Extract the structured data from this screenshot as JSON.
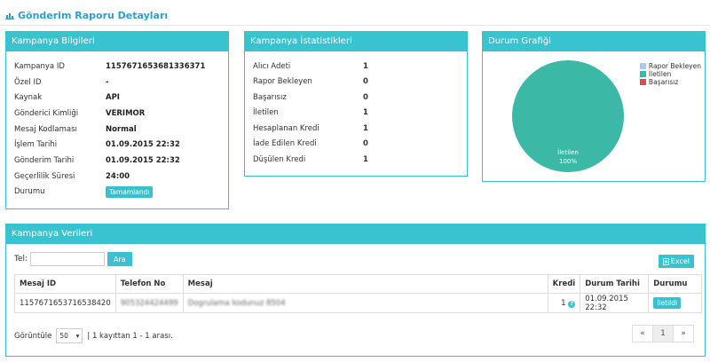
{
  "header": {
    "title": "Gönderim Raporu Detayları"
  },
  "campaign_info": {
    "title": "Kampanya Bilgileri",
    "rows": [
      {
        "key": "Kampanya ID",
        "value": "1157671653681336371"
      },
      {
        "key": "Özel ID",
        "value": "-"
      },
      {
        "key": "Kaynak",
        "value": "API"
      },
      {
        "key": "Gönderici Kimliği",
        "value": "VERIMOR"
      },
      {
        "key": "Mesaj Kodlaması",
        "value": "Normal"
      },
      {
        "key": "İşlem Tarihi",
        "value": "01.09.2015 22:32"
      },
      {
        "key": "Gönderim Tarihi",
        "value": "01.09.2015 22:32"
      },
      {
        "key": "Geçerlilik Süresi",
        "value": "24:00"
      }
    ],
    "status_label": "Durumu",
    "status_value": "Tamamlandı"
  },
  "campaign_stats": {
    "title": "Kampanya İstatistikleri",
    "rows": [
      {
        "key": "Alıcı Adeti",
        "value": "1"
      },
      {
        "key": "Rapor Bekleyen",
        "value": "0"
      },
      {
        "key": "Başarısız",
        "value": "0"
      },
      {
        "key": "İletilen",
        "value": "1"
      },
      {
        "key": "Hesaplanan Kredi",
        "value": "1"
      },
      {
        "key": "İade Edilen Kredi",
        "value": "0"
      },
      {
        "key": "Düşülen Kredi",
        "value": "1"
      }
    ]
  },
  "status_chart": {
    "title": "Durum Grafiği",
    "slice_label": "İletilen",
    "slice_percent": "100%",
    "legend": [
      {
        "name": "Rapor Bekleyen",
        "color": "#a9c9ee"
      },
      {
        "name": "İletilen",
        "color": "#3bb8a6"
      },
      {
        "name": "Başarısız",
        "color": "#e4484f"
      }
    ],
    "pie_color": "#3bb8a6"
  },
  "chart_data": {
    "type": "pie",
    "categories": [
      "Rapor Bekleyen",
      "İletilen",
      "Başarısız"
    ],
    "values": [
      0,
      1,
      0
    ],
    "title": "Durum Grafiği",
    "legend_position": "top-right"
  },
  "campaign_data": {
    "title": "Kampanya Verileri",
    "tel_label": "Tel:",
    "search_button": "Ara",
    "excel_button": "Excel",
    "columns": [
      "Mesaj ID",
      "Telefon No",
      "Mesaj",
      "Kredi",
      "Durum Tarihi",
      "Durumu"
    ],
    "rows": [
      {
        "message_id": "1157671653716538420",
        "phone": "905324424499",
        "message": "Dogrulama kodunuz 8504",
        "credit": "1",
        "status_date": "01.09.2015 22:32",
        "status": "İletildi"
      }
    ],
    "page_size_label": "Görüntüle",
    "page_size": "50",
    "records_text": "| 1 kayıttan 1 - 1 arası.",
    "pager": {
      "prev": "«",
      "current": "1",
      "next": "»"
    }
  }
}
